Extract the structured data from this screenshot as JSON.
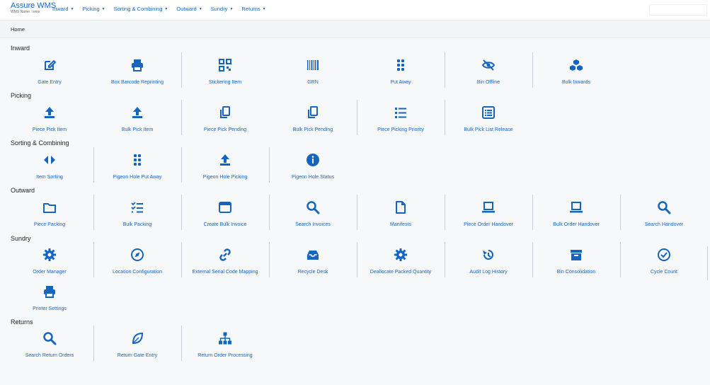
{
  "header": {
    "brand": "Assure WMS",
    "wms_name": "WMS Name : wms",
    "nav": [
      "Inward",
      "Picking",
      "Sorting & Combining",
      "Outward",
      "Sundry",
      "Returns"
    ]
  },
  "breadcrumb": "Home",
  "colors": {
    "accent": "#1565c0",
    "divider": "#c9ced4"
  },
  "sections": [
    {
      "title": "Inward",
      "items": [
        {
          "label": "Gate Entry",
          "icon": "edit-icon"
        },
        {
          "label": "Box Barcode Reprinting",
          "icon": "printer-icon"
        },
        {
          "label": "Stickering Item",
          "icon": "qr-code-icon"
        },
        {
          "label": "GRN",
          "icon": "barcode-icon"
        },
        {
          "label": "Put Away",
          "icon": "grid-dots-icon"
        },
        {
          "label": "Bin Offline",
          "icon": "eye-off-icon"
        },
        {
          "label": "Bulk Inwards",
          "icon": "boxes-icon"
        }
      ]
    },
    {
      "title": "Picking",
      "items": [
        {
          "label": "Piece Pick Item",
          "icon": "upload-icon"
        },
        {
          "label": "Bulk Pick Item",
          "icon": "upload-icon"
        },
        {
          "label": "Piece Pick Pending",
          "icon": "copy-icon"
        },
        {
          "label": "Bulk Pick Pending",
          "icon": "copy-icon"
        },
        {
          "label": "Piece Picking Priority",
          "icon": "list-icon"
        },
        {
          "label": "Bulk Pick List Release",
          "icon": "list-box-icon"
        }
      ]
    },
    {
      "title": "Sorting & Combining",
      "items": [
        {
          "label": "Item Sorting",
          "icon": "arrows-left-right-icon"
        },
        {
          "label": "Pigeon Hole Put Away",
          "icon": "grid-dots-icon"
        },
        {
          "label": "Pigeon Hole Picking",
          "icon": "upload-icon"
        },
        {
          "label": "Pigeon Hole Status",
          "icon": "info-icon"
        }
      ]
    },
    {
      "title": "Outward",
      "items": [
        {
          "label": "Piece Packing",
          "icon": "folder-icon"
        },
        {
          "label": "Bulk Packing",
          "icon": "checklist-icon"
        },
        {
          "label": "Create Bulk Invoice",
          "icon": "window-icon"
        },
        {
          "label": "Search Invoices",
          "icon": "search-icon"
        },
        {
          "label": "Manifests",
          "icon": "file-icon"
        },
        {
          "label": "Piece Order Handover",
          "icon": "laptop-icon"
        },
        {
          "label": "Bulk Order Handover",
          "icon": "laptop-icon"
        },
        {
          "label": "Search Handover",
          "icon": "search-icon"
        }
      ]
    },
    {
      "title": "Sundry",
      "items": [
        {
          "label": "Order Manager",
          "icon": "gear-icon"
        },
        {
          "label": "Location Configuration",
          "icon": "compass-icon"
        },
        {
          "label": "External Serial Code Mapping",
          "icon": "link-icon"
        },
        {
          "label": "Recycle Desk",
          "icon": "inbox-icon"
        },
        {
          "label": "Deallocate Packed Quantity",
          "icon": "gear-icon"
        },
        {
          "label": "Audit Log History",
          "icon": "history-icon"
        },
        {
          "label": "Bin Consolidation",
          "icon": "archive-icon"
        },
        {
          "label": "Cycle Count",
          "icon": "check-circle-icon"
        },
        {
          "label": "Printer Settings",
          "icon": "printer-icon"
        }
      ]
    },
    {
      "title": "Returns",
      "items": [
        {
          "label": "Search Return Orders",
          "icon": "search-icon"
        },
        {
          "label": "Return Gate Entry",
          "icon": "leaf-icon"
        },
        {
          "label": "Return Order Processing",
          "icon": "sitemap-icon"
        }
      ]
    }
  ]
}
